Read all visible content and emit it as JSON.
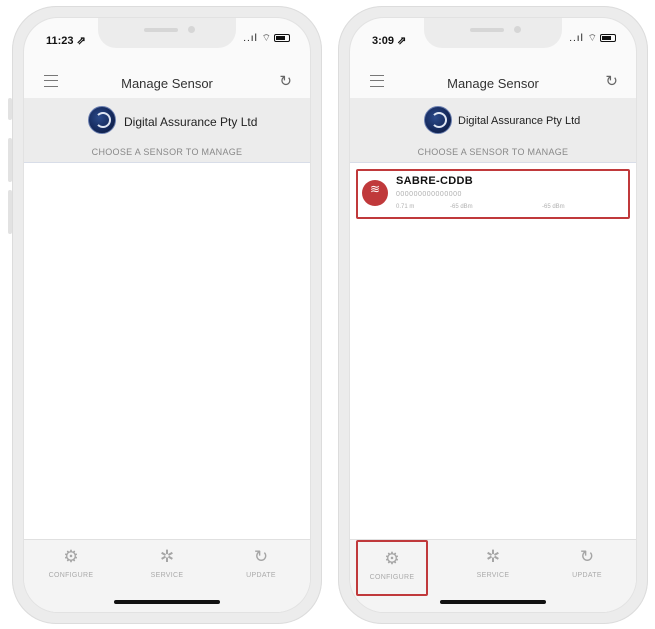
{
  "screens": {
    "left": {
      "status": {
        "time": "11:23 ⇗",
        "icons": "..ıl ⌔"
      },
      "nav": {
        "title": "Manage Sensor"
      },
      "company": {
        "name": "Digital Assurance Pty Ltd"
      },
      "choose_label": "CHOOSE A SENSOR TO MANAGE",
      "tabs": [
        {
          "icon": "⚙",
          "label": "CONFIGURE"
        },
        {
          "icon": "✲",
          "label": "SERVICE"
        },
        {
          "icon": "↻",
          "label": "UPDATE"
        }
      ]
    },
    "right": {
      "status": {
        "time": "3:09 ⇗",
        "icons": "..ıl ⌔"
      },
      "nav": {
        "title": "Manage Sensor"
      },
      "company": {
        "name": "Digital Assurance Pty Ltd"
      },
      "choose_label": "CHOOSE A SENSOR TO MANAGE",
      "sensor": {
        "name": "SABRE-CDDB",
        "id": "000000000000000",
        "distance": "0.71 m",
        "rssi_1": "-65 dBm",
        "rssi_2": "-65 dBm"
      },
      "tabs": [
        {
          "icon": "⚙",
          "label": "CONFIGURE"
        },
        {
          "icon": "✲",
          "label": "SERVICE"
        },
        {
          "icon": "↻",
          "label": "UPDATE"
        }
      ]
    }
  },
  "icons": {
    "refresh": "↻",
    "wifi": "≋"
  },
  "colors": {
    "accent_red": "#c0393b",
    "bar_bg": "#ececec"
  }
}
